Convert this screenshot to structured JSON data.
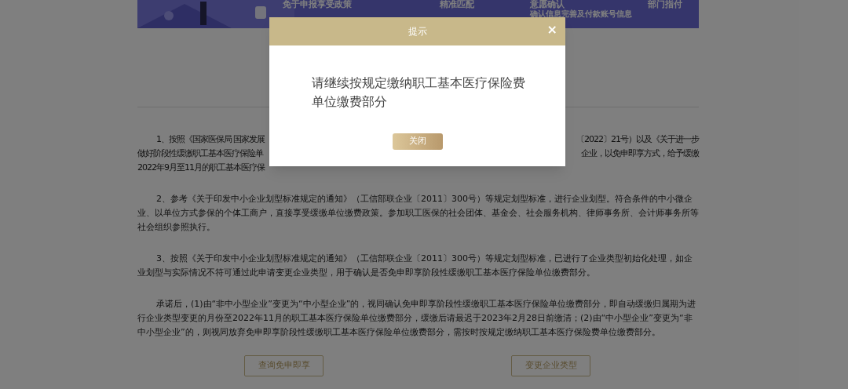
{
  "banner": {
    "steps": [
      "免于申报享受政策",
      "精准匹配",
      "意愿确认",
      "部门指付"
    ],
    "step_note": "确认信息完善及付款账号信息"
  },
  "paragraph_1_lines": [
    {
      "left": "1、按照《国家医保局 国家发展",
      "right": "〔2022〕21号）以及《关于进一步"
    },
    {
      "left": "做好阶段性缓缴职工基本医疗保险单",
      "right": "企业，以免申即享方式，给予缓缴"
    },
    {
      "left": "2022年9月至11月的职工基本医疗保"
    }
  ],
  "paragraphs": [
    "2、参考《关于印发中小企业划型标准规定的通知》（工信部联企业〔2011〕300号）等规定划型标准，进行企业划型。符合条件的中小微企业、以单位方式参保的个体工商户，直接享受缓缴单位缴费政策。参加职工医保的社会团体、基金会、社会服务机构、律师事务所、会计师事务所等社会组织参照执行。",
    "3、按照《关于印发中小企业划型标准规定的通知》（工信部联企业〔2011〕300号）等规定划型标准，已进行了企业类型初始化处理，如企业划型与实际情况不符可通过此申请变更企业类型，用于确认是否免申即享阶段性缓缴职工基本医疗保险单位缴费部分。",
    "承诺后，(1)由“非中小型企业”变更为“中小型企业”的，视同确认免申即享阶段性缓缴职工基本医疗保险单位缴费部分，即自动缓缴归属期为进行企业类型变更的月份至2022年11月的职工基本医疗保险单位缴费部分，缓缴后请最迟于2023年2月28日前缴清；(2)由“中小型企业”变更为“非中小型企业”的，则视同放弃免申即享阶段性缓缴职工基本医疗保险单位缴费部分，需按时按规定缴纳职工基本医疗保险费单位缴费部分。"
  ],
  "buttons": [
    "查询免申即享",
    "变更企业类型"
  ],
  "dialog": {
    "title": "提示",
    "close_icon": "×",
    "message": "请继续按规定缴纳职工基本医疗保险费单位缴费部分",
    "button": "关闭"
  }
}
